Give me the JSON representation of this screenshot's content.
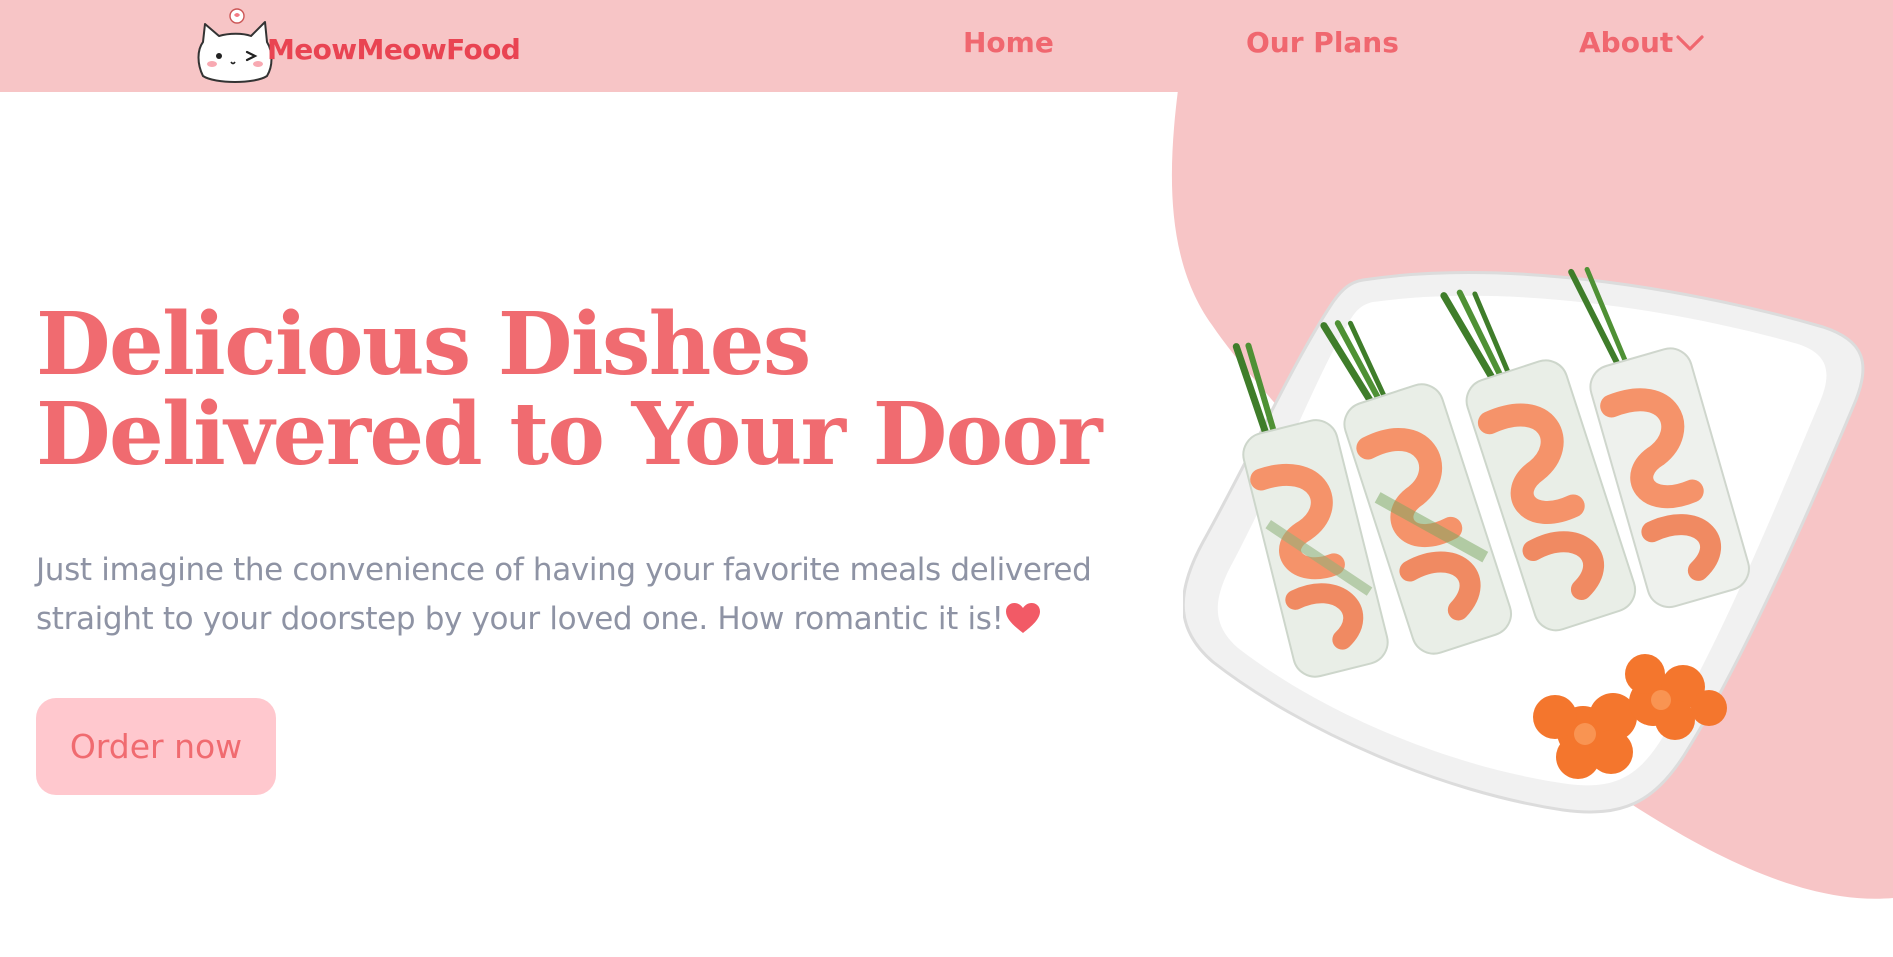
{
  "nav": {
    "brand": "MeowMeowFood",
    "logo_icon": "cat-face-logo",
    "links": [
      {
        "label": "Home"
      },
      {
        "label": "Our Plans"
      },
      {
        "label": "About",
        "icon": "chevron-down-icon"
      }
    ]
  },
  "hero": {
    "title_line1": "Delicious Dishes",
    "title_line2": "Delivered to Your Door",
    "desc_line1": "Just imagine the convenience of having your favorite meals delivered",
    "desc_line2": "straight to your doorstep by your loved one. How romantic it is!",
    "desc_icon": "heart-icon",
    "cta": "Order now",
    "image_subject": "shrimp spring rolls on a white square plate with carrot flowers"
  },
  "colors": {
    "nav_bg": "#f7c5c6",
    "brand": "#e94452",
    "accent": "#f06b70",
    "text_muted": "#8e93a4",
    "button_bg": "#ffc8ce",
    "blob": "#f7c5c6"
  }
}
